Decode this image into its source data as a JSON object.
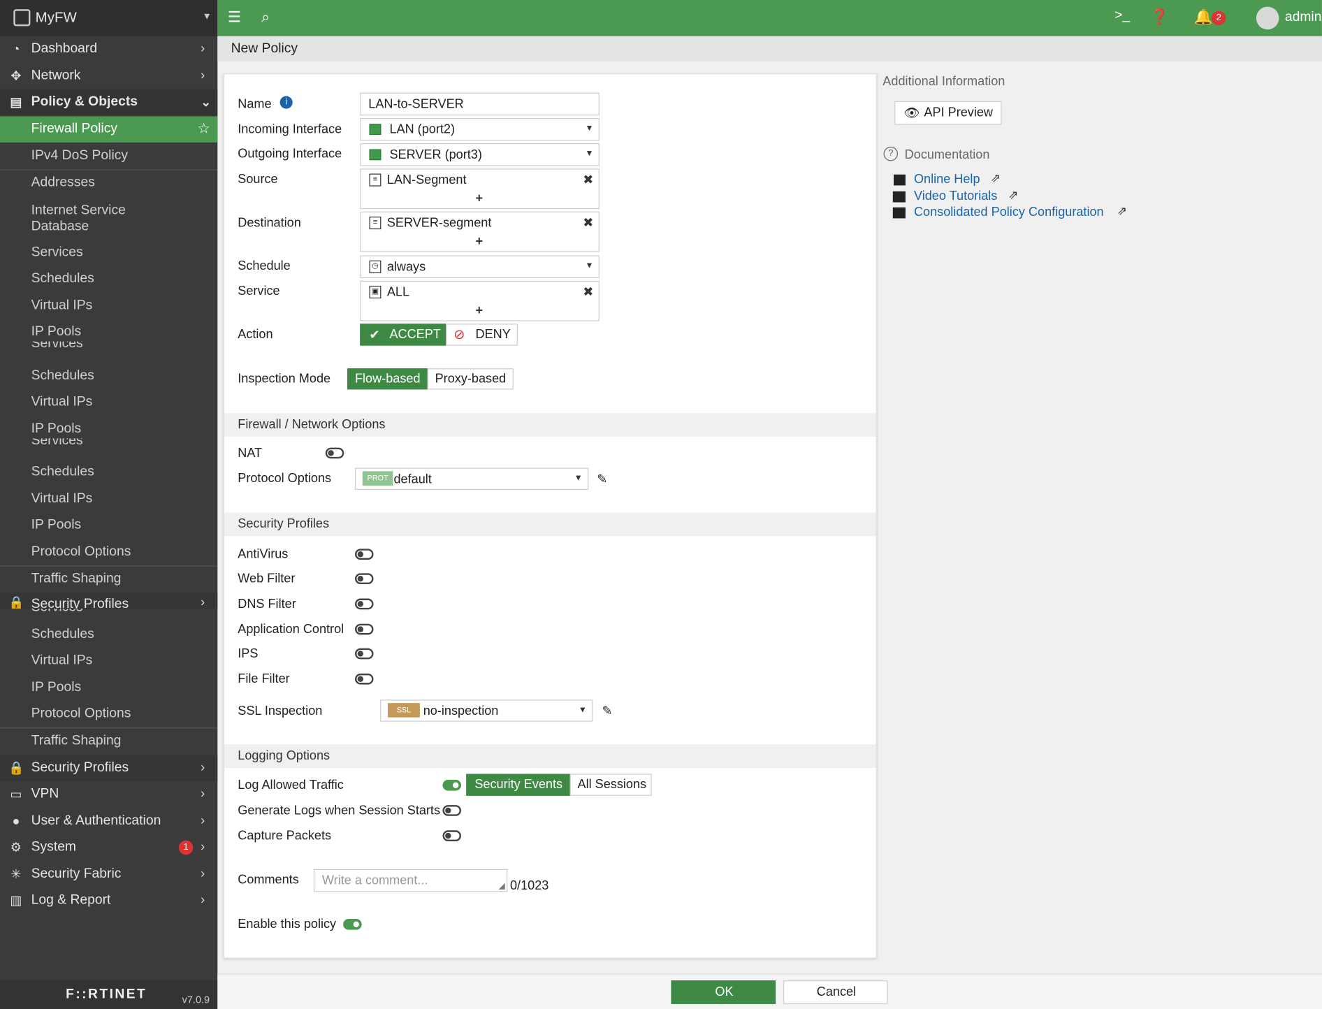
{
  "app": {
    "title": "MyFW",
    "version": "v7.0.9",
    "brand": "F::RTINET"
  },
  "sidebar": {
    "top_items": [
      {
        "icon": "dashboard-icon",
        "label": "Dashboard"
      },
      {
        "icon": "network-icon",
        "label": "Network"
      },
      {
        "icon": "policy-icon",
        "label": "Policy & Objects"
      }
    ],
    "policy_sub": [
      "Firewall Policy",
      "IPv4 DoS Policy",
      "Addresses",
      "Internet Service Database",
      "Services",
      "Schedules",
      "Virtual IPs",
      "IP Pools",
      "Services",
      "Schedules",
      "Virtual IPs",
      "IP Pools",
      "Services",
      "Schedules",
      "Virtual IPs",
      "IP Pools",
      "Protocol Options",
      "Traffic Shaping",
      "Security Profiles",
      "Services",
      "Schedules",
      "Virtual IPs",
      "IP Pools",
      "Protocol Options",
      "Traffic Shaping"
    ],
    "bottom_items": [
      {
        "icon": "lock-icon",
        "label": "Security Profiles"
      },
      {
        "icon": "vpn-icon",
        "label": "VPN"
      },
      {
        "icon": "user-icon",
        "label": "User & Authentication"
      },
      {
        "icon": "gear-icon",
        "label": "System",
        "badge": "1"
      },
      {
        "icon": "fabric-icon",
        "label": "Security Fabric"
      },
      {
        "icon": "report-icon",
        "label": "Log & Report"
      }
    ]
  },
  "topbar": {
    "notifications": "2",
    "user": "admin"
  },
  "breadcrumb": "New Policy",
  "form": {
    "name_label": "Name",
    "name_value": "LAN-to-SERVER",
    "incoming_label": "Incoming Interface",
    "incoming_value": "LAN (port2)",
    "outgoing_label": "Outgoing Interface",
    "outgoing_value": "SERVER (port3)",
    "source_label": "Source",
    "source_value": "LAN-Segment",
    "destination_label": "Destination",
    "destination_value": "SERVER-segment",
    "schedule_label": "Schedule",
    "schedule_value": "always",
    "service_label": "Service",
    "service_value": "ALL",
    "action_label": "Action",
    "accept_label": "ACCEPT",
    "deny_label": "DENY",
    "inspection_label": "Inspection Mode",
    "flow_label": "Flow-based",
    "proxy_label": "Proxy-based",
    "fw_section": "Firewall / Network Options",
    "nat_label": "NAT",
    "protocol_label": "Protocol Options",
    "protocol_tag": "PROT",
    "protocol_value": "default",
    "security_section": "Security Profiles",
    "profiles": [
      "AntiVirus",
      "Web Filter",
      "DNS Filter",
      "Application Control",
      "IPS",
      "File Filter"
    ],
    "ssl_label": "SSL Inspection",
    "ssl_tag": "SSL",
    "ssl_value": "no-inspection",
    "logging_section": "Logging Options",
    "log_allowed_label": "Log Allowed Traffic",
    "security_events_label": "Security Events",
    "all_sessions_label": "All Sessions",
    "gen_logs_label": "Generate Logs when Session Starts",
    "capture_label": "Capture Packets",
    "comments_label": "Comments",
    "comments_placeholder": "Write a comment...",
    "comments_count": "0/1023",
    "enable_label": "Enable this policy"
  },
  "info": {
    "title": "Additional Information",
    "api_preview": "API Preview",
    "doc_title": "Documentation",
    "links": [
      "Online Help",
      "Video Tutorials",
      "Consolidated Policy Configuration"
    ]
  },
  "buttons": {
    "ok": "OK",
    "cancel": "Cancel"
  },
  "colors": {
    "accent": "#4c9a52",
    "sidebar": "#3b3b3b",
    "link": "#1a63a8",
    "badge": "#dd3333"
  }
}
